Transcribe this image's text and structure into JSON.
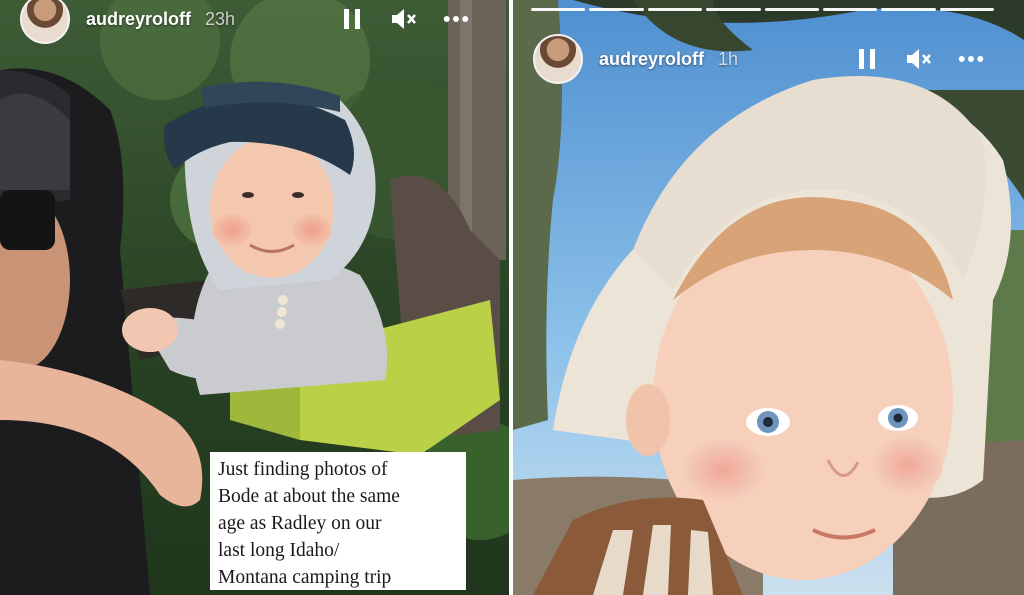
{
  "stories": [
    {
      "username": "audreyroloff",
      "timestamp": "23h",
      "caption": "Just finding photos of\nBode at about the same\nage as Radley on our\nlast long Idaho/\nMontana camping trip"
    },
    {
      "username": "audreyroloff",
      "timestamp": "1h",
      "progress_segments": 8
    }
  ],
  "icons": {
    "pause": "pause-icon",
    "mute": "muted-speaker-icon",
    "more": "more-options-icon"
  },
  "colors": {
    "text": "#ffffff",
    "caption_bg": "#ffffff",
    "caption_text": "#1a1a1a"
  }
}
